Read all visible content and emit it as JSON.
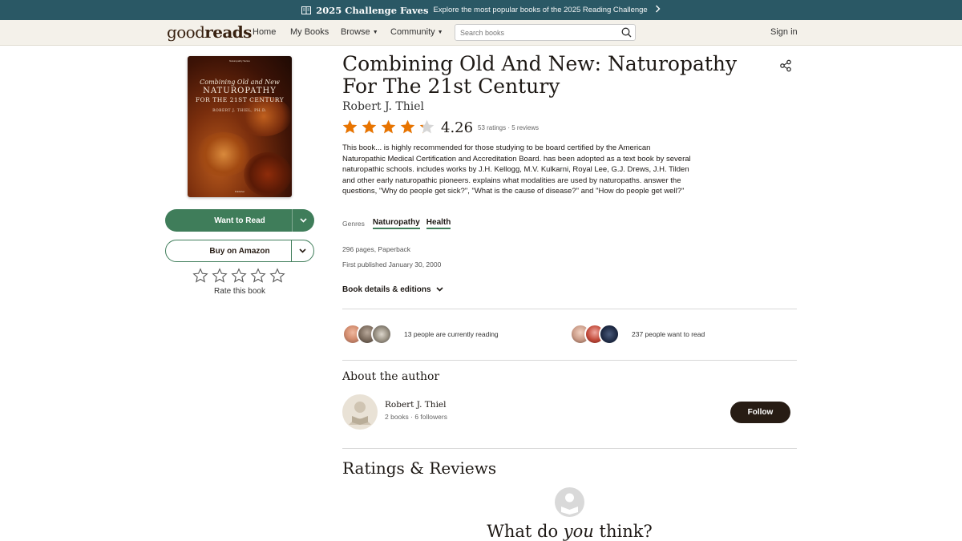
{
  "promo": {
    "title": "2025 Challenge Faves",
    "text": "Explore the most popular books of the 2025 Reading Challenge"
  },
  "header": {
    "logo_left": "good",
    "logo_right": "reads",
    "nav": {
      "home": "Home",
      "my_books": "My Books",
      "browse": "Browse",
      "community": "Community"
    },
    "search_placeholder": "Search books",
    "sign_in": "Sign in"
  },
  "cover": {
    "top_text": "Naturopathy Series",
    "subtitle": "Combining Old and New",
    "title_line1": "NATUROPATHY",
    "title_line2": "FOR THE 21ST CENTURY",
    "author": "ROBERT J. THIEL, PH.D.",
    "foot": "Publisher"
  },
  "actions": {
    "want_to_read": "Want to Read",
    "buy_amazon": "Buy on Amazon",
    "rate_label": "Rate this book"
  },
  "book": {
    "title": "Combining Old And New: Naturopathy For The 21st Century",
    "author": "Robert J. Thiel",
    "average_rating": "4.26",
    "rating_value": 4.26,
    "ratings_count": "53 ratings",
    "reviews_count": "5 reviews",
    "description": "This book... is highly recommended for those studying to be board certified by the American Naturopathic Medical Certification and Accreditation Board. has been adopted as a text book by several naturopathic schools. includes works by J.H. Kellogg, M.V. Kulkarni, Royal Lee, G.J. Drews, J.H. Tilden and other early naturopathic pioneers. explains what modalities are used by naturopaths. answer the questions, \"Why do people get sick?\", \"What is the cause of disease?\" and \"How do people get well?\"",
    "genres_label": "Genres",
    "genres": [
      "Naturopathy",
      "Health"
    ],
    "pages": "296 pages, Paperback",
    "published": "First published January 30, 2000",
    "details_link": "Book details & editions"
  },
  "social": {
    "currently_reading": "13 people are currently reading",
    "want_to_read": "237 people want to read"
  },
  "about": {
    "heading": "About the author",
    "name": "Robert J. Thiel",
    "books": "2 books",
    "followers": "6 followers",
    "follow": "Follow"
  },
  "reviews": {
    "heading": "Ratings & Reviews",
    "think_pre": "What do ",
    "think_em": "you",
    "think_post": " think?"
  },
  "colors": {
    "banner": "#2a5865",
    "header_bg": "#f4f1ea",
    "green": "#3f7d5a",
    "star": "#e87400",
    "dark_button": "#271c14"
  }
}
